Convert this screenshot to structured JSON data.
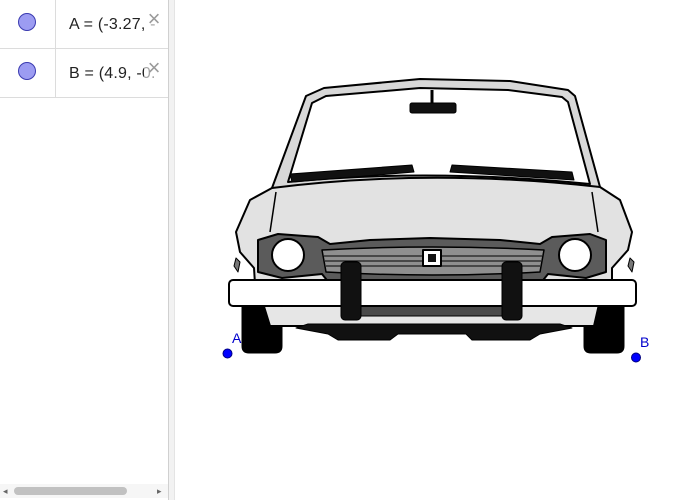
{
  "algebra": {
    "objects": [
      {
        "label": "A = (-3.27, -",
        "color": "#9c9cf2"
      },
      {
        "label": "B = (4.9, -0.",
        "color": "#9c9cf2"
      }
    ],
    "delete_symbol": "×"
  },
  "scrollbar": {
    "left_arrow": "◂",
    "right_arrow": "▸",
    "position": 0.1
  },
  "graphics": {
    "image_subject": "car-front",
    "points": [
      {
        "name": "A",
        "color": "#0000ff"
      },
      {
        "name": "B",
        "color": "#0000ff"
      }
    ]
  },
  "colors": {
    "point": "#0000ff",
    "marble": "#9c9cf2",
    "label": "#0000cc"
  }
}
